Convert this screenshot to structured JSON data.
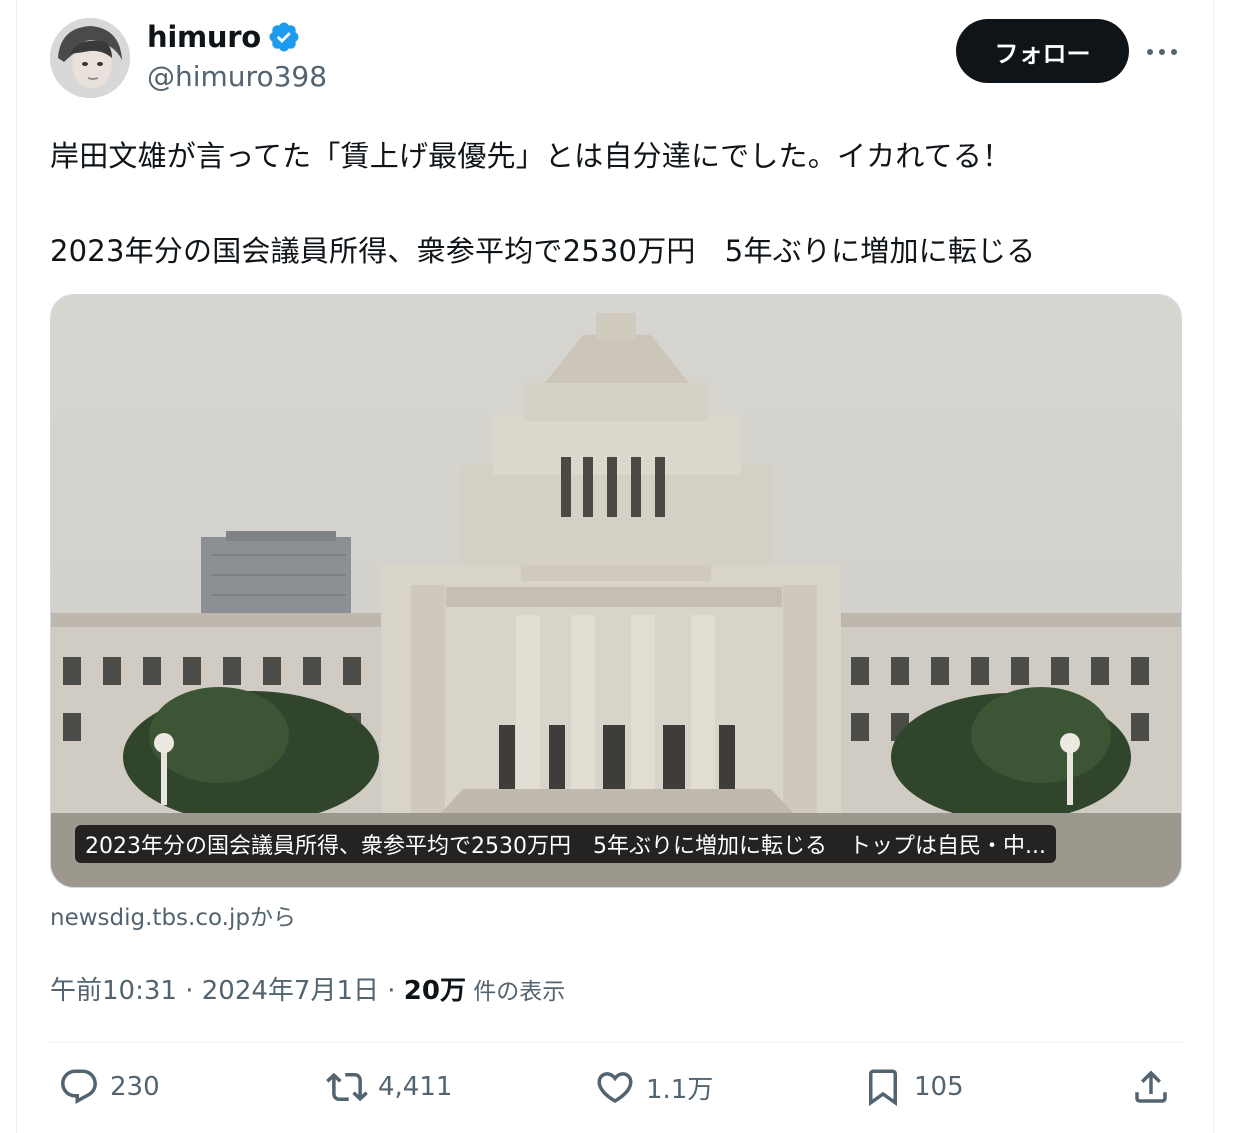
{
  "author": {
    "name": "himuro",
    "handle": "@himuro398",
    "verified_icon": "verified-badge-icon",
    "verified_color": "#1d9bf0"
  },
  "follow_label": "フォロー",
  "tweet": {
    "line1": "岸田文雄が言ってた「賃上げ最優先」とは自分達にでした。イカれてる！",
    "line2": "2023年分の国会議員所得、衆参平均で2530万円　5年ぶりに増加に転じる"
  },
  "card": {
    "caption": "2023年分の国会議員所得、衆参平均で2530万円　5年ぶりに増加に転じる　トップは自民・中...",
    "source": "newsdig.tbs.co.jpから"
  },
  "meta": {
    "time": "午前10:31",
    "sep1": " · ",
    "date": "2024年7月1日",
    "sep2": " · ",
    "views": "20万",
    "views_suffix": " 件の表示"
  },
  "actions": {
    "replies": "230",
    "reposts": "4,411",
    "likes": "1.1万",
    "bookmarks": "105"
  }
}
